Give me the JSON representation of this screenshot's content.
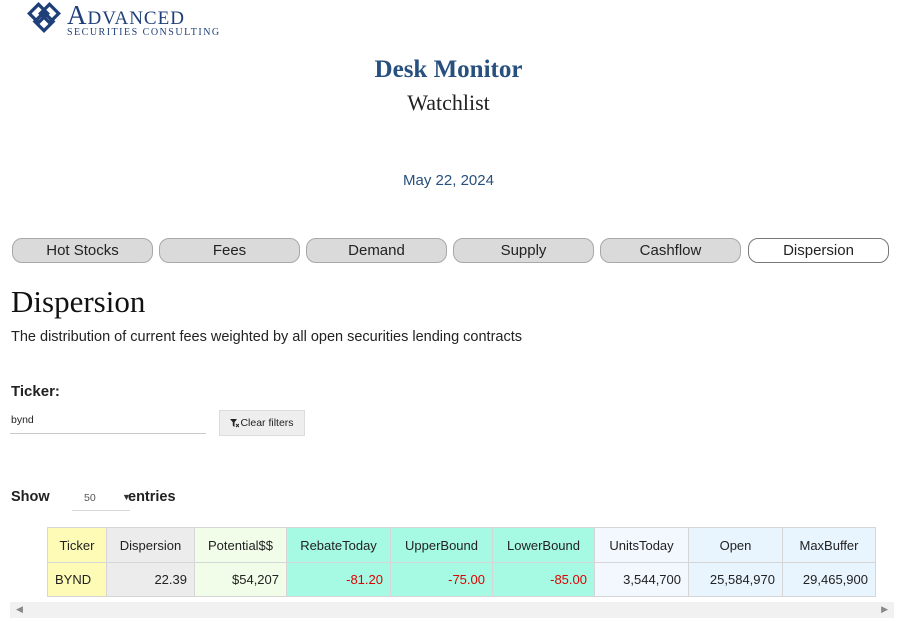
{
  "brand": {
    "name": "Advanced",
    "tagline": "SECURITIES CONSULTING",
    "logo_icon": "interlocking-diamonds-logo"
  },
  "header": {
    "title": "Desk Monitor",
    "subtitle": "Watchlist",
    "date": "May 22, 2024"
  },
  "tabs": [
    {
      "label": "Hot Stocks",
      "active": false
    },
    {
      "label": "Fees",
      "active": false
    },
    {
      "label": "Demand",
      "active": false
    },
    {
      "label": "Supply",
      "active": false
    },
    {
      "label": "Cashflow",
      "active": false
    },
    {
      "label": "Dispersion",
      "active": true
    }
  ],
  "section": {
    "heading": "Dispersion",
    "description": "The distribution of current fees weighted by all open securities lending contracts"
  },
  "filters": {
    "ticker_label": "Ticker:",
    "ticker_value": "bynd",
    "clear_label": "Clear filters",
    "clear_icon": "filter-clear-icon"
  },
  "entries": {
    "show_label": "Show",
    "page_size": "50",
    "entries_label": "entries"
  },
  "table": {
    "columns": [
      {
        "key": "ticker",
        "label": "Ticker",
        "bg": "#fdfbb6"
      },
      {
        "key": "dispersion",
        "label": "Dispersion",
        "bg": "#ececec"
      },
      {
        "key": "potential",
        "label": "Potential$$",
        "bg": "#f1fde9"
      },
      {
        "key": "rebate_today",
        "label": "RebateToday",
        "bg": "#a6fae3"
      },
      {
        "key": "upper_bound",
        "label": "UpperBound",
        "bg": "#a6fae3"
      },
      {
        "key": "lower_bound",
        "label": "LowerBound",
        "bg": "#a6fae3"
      },
      {
        "key": "units_today",
        "label": "UnitsToday",
        "bg": "#f2f8fe"
      },
      {
        "key": "open",
        "label": "Open",
        "bg": "#e8f4fe"
      },
      {
        "key": "max_buffer",
        "label": "MaxBuffer",
        "bg": "#e8f4fe"
      }
    ],
    "rows": [
      {
        "ticker": "BYND",
        "dispersion": "22.39",
        "potential": "$54,207",
        "rebate_today": "-81.20",
        "upper_bound": "-75.00",
        "lower_bound": "-85.00",
        "units_today": "3,544,700",
        "open": "25,584,970",
        "max_buffer": "29,465,900"
      }
    ],
    "negative_color": "#e00000"
  },
  "colors": {
    "accent": "#27507e",
    "brand": "#1f3f78"
  }
}
